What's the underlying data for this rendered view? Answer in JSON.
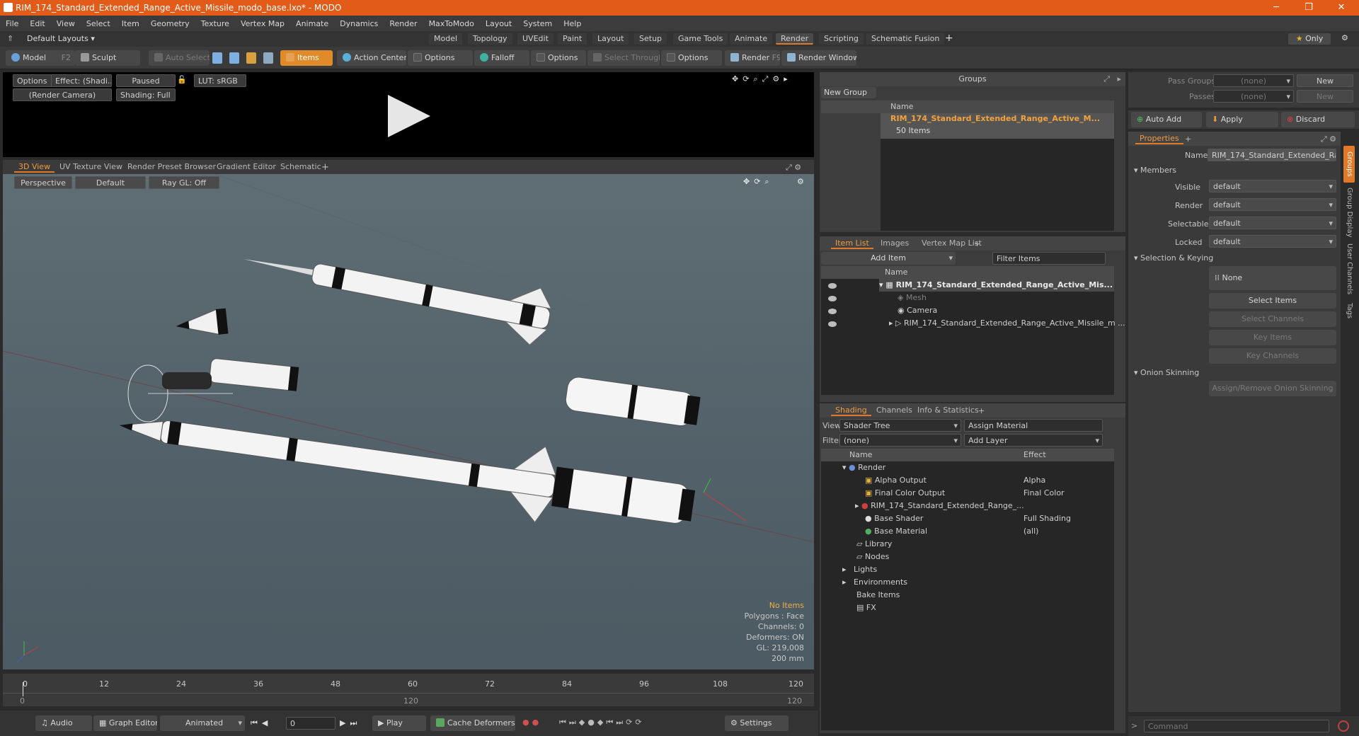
{
  "window": {
    "title": "RIM_174_Standard_Extended_Range_Active_Missile_modo_base.lxo* - MODO"
  },
  "menu": [
    "File",
    "Edit",
    "View",
    "Select",
    "Item",
    "Geometry",
    "Texture",
    "Vertex Map",
    "Animate",
    "Dynamics",
    "Render",
    "MaxToModo",
    "Layout",
    "System",
    "Help"
  ],
  "layouts": {
    "default": "Default Layouts",
    "tabs": [
      "Model",
      "Topology",
      "UVEdit",
      "Paint",
      "Layout",
      "Setup",
      "Game Tools",
      "Animate",
      "Render",
      "Scripting",
      "Schematic Fusion"
    ],
    "active": "Render",
    "only": "Only"
  },
  "toolbar": {
    "model": "Model",
    "model_key": "F2",
    "sculpt": "Sculpt",
    "auto_select": "Auto Select",
    "items": "Items",
    "action_center": "Action Center",
    "options1": "Options",
    "falloff": "Falloff",
    "options2": "Options",
    "select_through": "Select Through",
    "options3": "Options",
    "render": "Render",
    "render_key": "F9",
    "render_window": "Render Window"
  },
  "preview": {
    "options": "Options",
    "effect": "Effect: (Shadi...",
    "paused": "Paused",
    "lut": "LUT: sRGB",
    "camera": "(Render Camera)",
    "shading": "Shading: Full"
  },
  "viewtabs": [
    "3D View",
    "UV Texture View",
    "Render Preset Browser",
    "Gradient Editor",
    "Schematic"
  ],
  "viewport": {
    "perspective": "Perspective",
    "default": "Default",
    "raygl": "Ray GL: Off",
    "info": [
      "No Items",
      "Polygons : Face",
      "Channels: 0",
      "Deformers: ON",
      "GL: 219,008",
      "200 mm"
    ]
  },
  "timeline": {
    "ticks": [
      "0",
      "12",
      "24",
      "36",
      "48",
      "60",
      "72",
      "84",
      "96",
      "108",
      "120"
    ],
    "sub_left": "0",
    "sub_mid": "120",
    "sub_right": "120"
  },
  "bottombar": {
    "audio": "Audio",
    "graph_editor": "Graph Editor",
    "animated": "Animated",
    "frame": "0",
    "play": "Play",
    "cache_deformers": "Cache Deformers",
    "settings": "Settings"
  },
  "groups": {
    "title": "Groups",
    "new_group": "New Group",
    "col_name": "Name",
    "item_name": "RIM_174_Standard_Extended_Range_Active_M...",
    "item_count": "50 Items"
  },
  "itemlist": {
    "tabs": [
      "Item List",
      "Images",
      "Vertex Map List"
    ],
    "add_item": "Add Item",
    "filter": "Filter Items",
    "col_name": "Name",
    "rows": [
      "RIM_174_Standard_Extended_Range_Active_Mis...",
      "Mesh",
      "Camera",
      "RIM_174_Standard_Extended_Range_Active_Missile_m ..."
    ]
  },
  "shading": {
    "tabs": [
      "Shading",
      "Channels",
      "Info & Statistics"
    ],
    "view_label": "View",
    "view_value": "Shader Tree",
    "assign_material": "Assign Material",
    "filter_label": "Filter",
    "filter_value": "(none)",
    "add_layer": "Add Layer",
    "col_name": "Name",
    "col_effect": "Effect",
    "rows": [
      {
        "name": "Render",
        "effect": ""
      },
      {
        "name": "Alpha Output",
        "effect": "Alpha"
      },
      {
        "name": "Final Color Output",
        "effect": "Final Color"
      },
      {
        "name": "RIM_174_Standard_Extended_Range_...",
        "effect": ""
      },
      {
        "name": "Base Shader",
        "effect": "Full Shading"
      },
      {
        "name": "Base Material",
        "effect": "(all)"
      },
      {
        "name": "Library",
        "effect": ""
      },
      {
        "name": "Nodes",
        "effect": ""
      },
      {
        "name": "Lights",
        "effect": ""
      },
      {
        "name": "Environments",
        "effect": ""
      },
      {
        "name": "Bake Items",
        "effect": ""
      },
      {
        "name": "FX",
        "effect": ""
      }
    ]
  },
  "passes": {
    "pass_groups": "Pass Groups",
    "passes": "Passes",
    "none": "(none)",
    "new": "New",
    "auto_add": "Auto Add",
    "apply": "Apply",
    "discard": "Discard"
  },
  "properties": {
    "tab": "Properties",
    "name_label": "Name",
    "name_value": "RIM_174_Standard_Extended_Rang",
    "members": "Members",
    "fields": [
      {
        "label": "Visible",
        "value": "default"
      },
      {
        "label": "Render",
        "value": "default"
      },
      {
        "label": "Selectable",
        "value": "default"
      },
      {
        "label": "Locked",
        "value": "default"
      }
    ],
    "selection_keying": "Selection & Keying",
    "none": "None",
    "select_items": "Select Items",
    "select_channels": "Select Channels",
    "key_items": "Key Items",
    "key_channels": "Key Channels",
    "onion": "Onion Skinning",
    "onion_btn": "Assign/Remove Onion Skinning",
    "side_tabs": [
      "Groups",
      "Group Display",
      "User Channels",
      "Tags"
    ],
    "command": "Command"
  }
}
